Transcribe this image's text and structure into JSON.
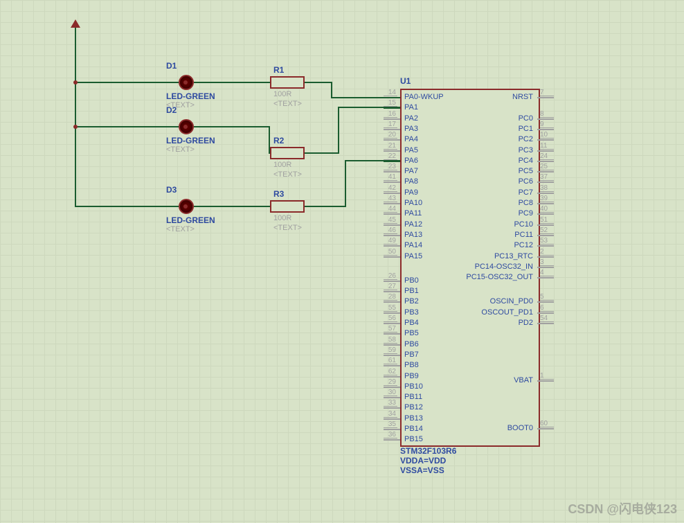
{
  "watermark": "CSDN @闪电侠123",
  "components": {
    "power_arrow": {
      "label": ""
    },
    "d1": {
      "ref": "D1",
      "value": "LED-GREEN",
      "text": "<TEXT>"
    },
    "d2": {
      "ref": "D2",
      "value": "LED-GREEN",
      "text": "<TEXT>"
    },
    "d3": {
      "ref": "D3",
      "value": "LED-GREEN",
      "text": "<TEXT>"
    },
    "r1": {
      "ref": "R1",
      "value": "100R",
      "text": "<TEXT>"
    },
    "r2": {
      "ref": "R2",
      "value": "100R",
      "text": "<TEXT>"
    },
    "r3": {
      "ref": "R3",
      "value": "100R",
      "text": "<TEXT>"
    },
    "u1": {
      "ref": "U1",
      "value": "STM32F103R6",
      "vdda": "VDDA=VDD",
      "vssa": "VSSA=VSS",
      "left_pins": [
        {
          "num": "14",
          "name": "PA0-WKUP"
        },
        {
          "num": "15",
          "name": "PA1"
        },
        {
          "num": "16",
          "name": "PA2"
        },
        {
          "num": "17",
          "name": "PA3"
        },
        {
          "num": "20",
          "name": "PA4"
        },
        {
          "num": "21",
          "name": "PA5"
        },
        {
          "num": "22",
          "name": "PA6"
        },
        {
          "num": "23",
          "name": "PA7"
        },
        {
          "num": "41",
          "name": "PA8"
        },
        {
          "num": "42",
          "name": "PA9"
        },
        {
          "num": "43",
          "name": "PA10"
        },
        {
          "num": "44",
          "name": "PA11"
        },
        {
          "num": "45",
          "name": "PA12"
        },
        {
          "num": "46",
          "name": "PA13"
        },
        {
          "num": "49",
          "name": "PA14"
        },
        {
          "num": "50",
          "name": "PA15"
        }
      ],
      "left_pins2": [
        {
          "num": "26",
          "name": "PB0"
        },
        {
          "num": "27",
          "name": "PB1"
        },
        {
          "num": "28",
          "name": "PB2"
        },
        {
          "num": "55",
          "name": "PB3"
        },
        {
          "num": "56",
          "name": "PB4"
        },
        {
          "num": "57",
          "name": "PB5"
        },
        {
          "num": "58",
          "name": "PB6"
        },
        {
          "num": "59",
          "name": "PB7"
        },
        {
          "num": "61",
          "name": "PB8"
        },
        {
          "num": "62",
          "name": "PB9"
        },
        {
          "num": "29",
          "name": "PB10"
        },
        {
          "num": "30",
          "name": "PB11"
        },
        {
          "num": "33",
          "name": "PB12"
        },
        {
          "num": "34",
          "name": "PB13"
        },
        {
          "num": "35",
          "name": "PB14"
        },
        {
          "num": "36",
          "name": "PB15"
        }
      ],
      "right_pins": [
        {
          "num": "7",
          "name": "NRST"
        },
        {
          "num": "",
          "name": ""
        },
        {
          "num": "8",
          "name": "PC0"
        },
        {
          "num": "9",
          "name": "PC1"
        },
        {
          "num": "10",
          "name": "PC2"
        },
        {
          "num": "11",
          "name": "PC3"
        },
        {
          "num": "24",
          "name": "PC4"
        },
        {
          "num": "25",
          "name": "PC5"
        },
        {
          "num": "37",
          "name": "PC6"
        },
        {
          "num": "38",
          "name": "PC7"
        },
        {
          "num": "39",
          "name": "PC8"
        },
        {
          "num": "40",
          "name": "PC9"
        },
        {
          "num": "51",
          "name": "PC10"
        },
        {
          "num": "52",
          "name": "PC11"
        },
        {
          "num": "53",
          "name": "PC12"
        },
        {
          "num": "2",
          "name": "PC13_RTC"
        },
        {
          "num": "3",
          "name": "PC14-OSC32_IN"
        },
        {
          "num": "4",
          "name": "PC15-OSC32_OUT"
        }
      ],
      "right_pins2": [
        {
          "num": "5",
          "name": "OSCIN_PD0"
        },
        {
          "num": "6",
          "name": "OSCOUT_PD1"
        },
        {
          "num": "54",
          "name": "PD2"
        }
      ],
      "right_pins3": [
        {
          "num": "1",
          "name": "VBAT"
        }
      ],
      "right_pins4": [
        {
          "num": "60",
          "name": "BOOT0"
        }
      ]
    }
  }
}
